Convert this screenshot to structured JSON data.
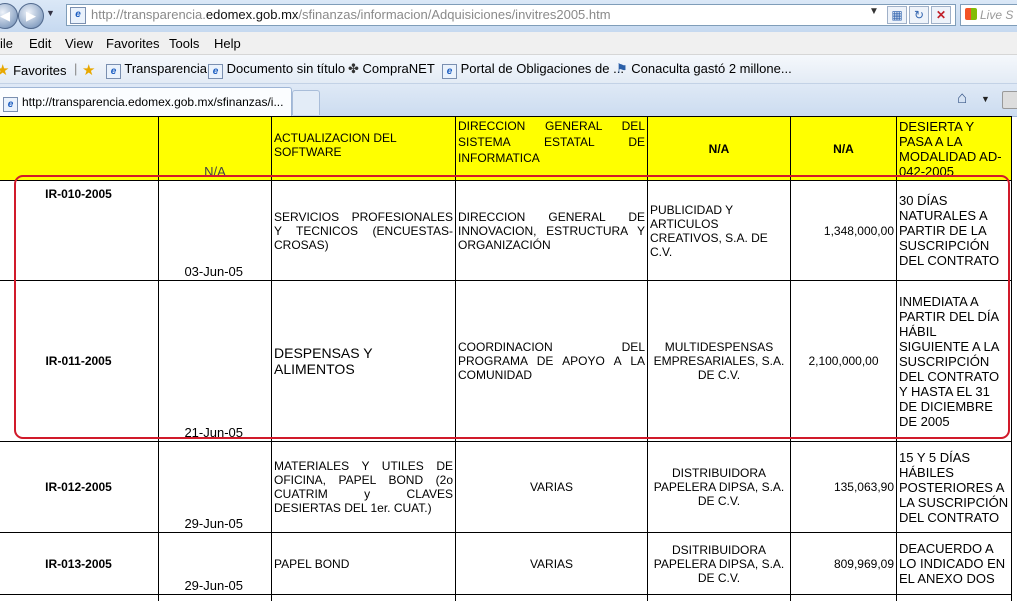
{
  "browser": {
    "url_prefix": "http://transparencia.",
    "url_domain": "edomex.gob.mx",
    "url_path": "/sfinanzas/informacion/Adquisiciones/invitres2005.htm",
    "search_placeholder": "Live S",
    "menu": [
      "ile",
      "Edit",
      "View",
      "Favorites",
      "Tools",
      "Help"
    ],
    "favorites_label": "Favorites",
    "favorites": [
      "Transparencia",
      "Documento sin título",
      "CompraNET",
      "Portal de Obligaciones de ...",
      "Conaculta gastó 2 millone..."
    ],
    "tab_title": "http://transparencia.edomex.gob.mx/sfinanzas/i..."
  },
  "table": {
    "top_row": {
      "date": "N/A",
      "description": "ACTUALIZACION DEL SOFTWARE",
      "area": "DIRECCION GENERAL DEL SISTEMA ESTATAL DE INFORMATICA",
      "supplier": "N/A",
      "amount": "N/A",
      "terms": "DESIERTA Y PASA A LA MODALIDAD AD-042-2005"
    },
    "rows": [
      {
        "id": "IR-010-2005",
        "date": "03-Jun-05",
        "description": "SERVICIOS PROFESIONALES Y TECNICOS (ENCUESTAS-CROSAS)",
        "area": "DIRECCION GENERAL DE INNOVACION, ESTRUCTURA Y ORGANIZACIÓN",
        "supplier": "PUBLICIDAD Y ARTICULOS CREATIVOS, S.A. DE C.V.",
        "amount": "1,348,000,00",
        "terms": "30 DÍAS NATURALES A PARTIR DE LA SUSCRIPCIÓN DEL CONTRATO"
      },
      {
        "id": "IR-011-2005",
        "date": "21-Jun-05",
        "description": "DESPENSAS Y ALIMENTOS",
        "area": "COORDINACION DEL PROGRAMA DE APOYO A LA COMUNIDAD",
        "supplier": "MULTIDESPENSAS EMPRESARIALES, S.A. DE C.V.",
        "amount": "2,100,000,00",
        "terms": "INMEDIATA A PARTIR DEL DÍA HÁBIL SIGUIENTE A LA SUSCRIPCIÓN DEL CONTRATO Y HASTA EL 31 DE DICIEMBRE DE 2005"
      },
      {
        "id": "IR-012-2005",
        "date": "29-Jun-05",
        "description": "MATERIALES Y UTILES DE OFICINA, PAPEL BOND (2o CUATRIM y CLAVES DESIERTAS DEL 1er. CUAT.)",
        "area": "VARIAS",
        "supplier": "DISTRIBUIDORA PAPELERA DIPSA, S.A. DE C.V.",
        "amount": "135,063,90",
        "terms": "15 Y 5 DÍAS HÁBILES POSTERIORES A LA SUSCRIPCIÓN DEL CONTRATO"
      },
      {
        "id": "IR-013-2005",
        "date": "29-Jun-05",
        "description": "PAPEL BOND",
        "area": "VARIAS",
        "supplier": "DSITRIBUIDORA PAPELERA DIPSA, S.A. DE C.V.",
        "amount": "809,969,09",
        "terms": "DEACUERDO A LO INDICADO EN EL ANEXO DOS"
      }
    ]
  },
  "colors": {
    "header_bg": "#ffff00",
    "highlight": "#d11a2a"
  }
}
